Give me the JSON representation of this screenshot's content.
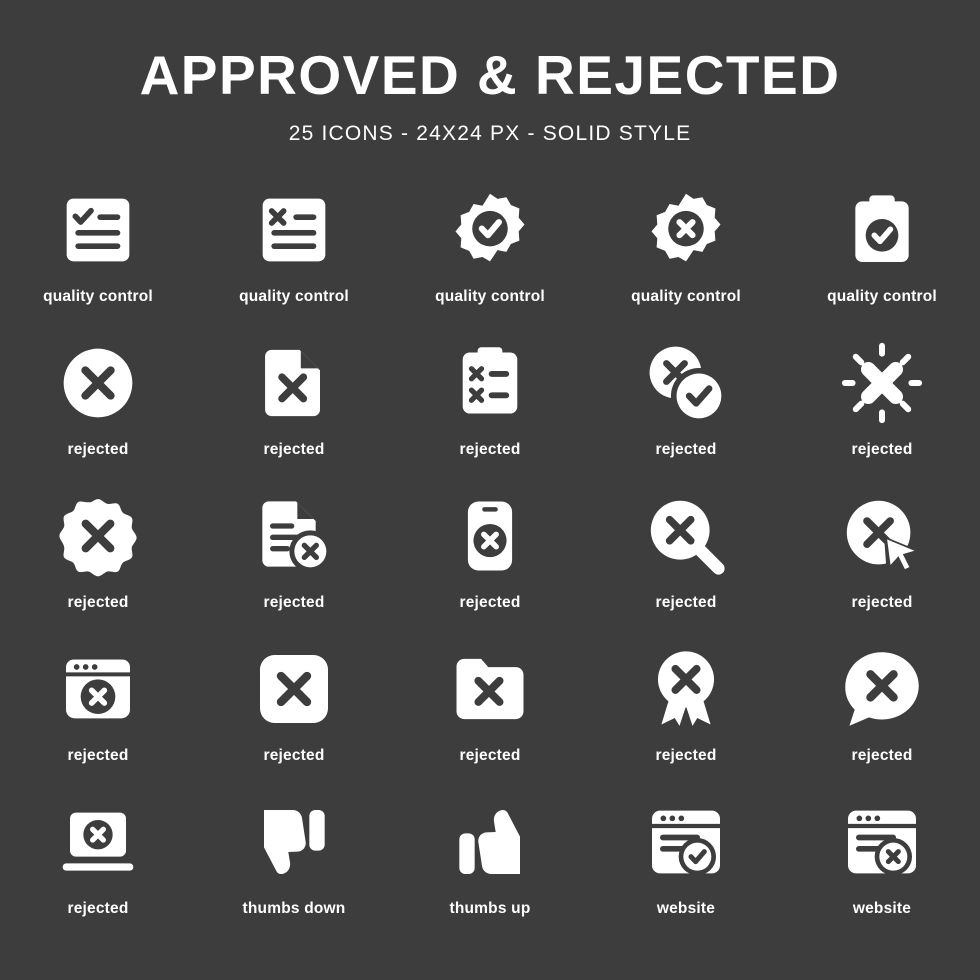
{
  "header": {
    "title": "APPROVED & REJECTED",
    "subtitle": "25 ICONS - 24X24 PX - SOLID STYLE"
  },
  "colors": {
    "background": "#3d3d3d",
    "foreground": "#ffffff"
  },
  "icons": [
    {
      "label": "quality control",
      "name": "document-checklist-approved-icon"
    },
    {
      "label": "quality control",
      "name": "document-checklist-rejected-icon"
    },
    {
      "label": "quality control",
      "name": "gear-check-icon"
    },
    {
      "label": "quality control",
      "name": "gear-cross-icon"
    },
    {
      "label": "quality control",
      "name": "clipboard-check-icon"
    },
    {
      "label": "rejected",
      "name": "circle-cross-icon"
    },
    {
      "label": "rejected",
      "name": "file-cross-icon"
    },
    {
      "label": "rejected",
      "name": "clipboard-cross-list-icon"
    },
    {
      "label": "rejected",
      "name": "cross-check-circles-icon"
    },
    {
      "label": "rejected",
      "name": "cross-rays-icon"
    },
    {
      "label": "rejected",
      "name": "badge-cross-icon"
    },
    {
      "label": "rejected",
      "name": "document-cross-badge-icon"
    },
    {
      "label": "rejected",
      "name": "mobile-cross-icon"
    },
    {
      "label": "rejected",
      "name": "magnifier-cross-icon"
    },
    {
      "label": "rejected",
      "name": "circle-cross-cursor-icon"
    },
    {
      "label": "rejected",
      "name": "browser-window-cross-icon"
    },
    {
      "label": "rejected",
      "name": "rounded-square-cross-icon"
    },
    {
      "label": "rejected",
      "name": "folder-cross-icon"
    },
    {
      "label": "rejected",
      "name": "award-ribbon-cross-icon"
    },
    {
      "label": "rejected",
      "name": "speech-bubble-cross-icon"
    },
    {
      "label": "rejected",
      "name": "laptop-cross-icon"
    },
    {
      "label": "thumbs down",
      "name": "thumbs-down-icon"
    },
    {
      "label": "thumbs up",
      "name": "thumbs-up-icon"
    },
    {
      "label": "website",
      "name": "website-check-icon"
    },
    {
      "label": "website",
      "name": "website-cross-icon"
    }
  ]
}
